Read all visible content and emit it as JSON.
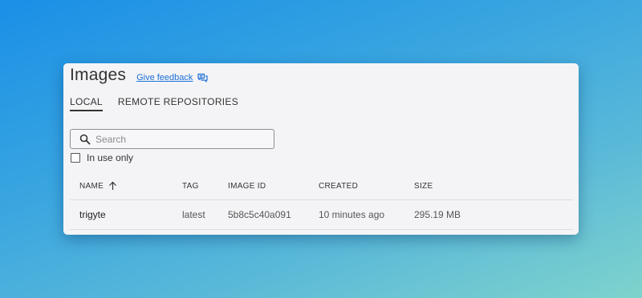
{
  "header": {
    "title": "Images",
    "feedback_label": "Give feedback",
    "feedback_icon": "chat-bubbles-icon"
  },
  "tabs": [
    {
      "label": "LOCAL",
      "active": true
    },
    {
      "label": "REMOTE REPOSITORIES",
      "active": false
    }
  ],
  "search": {
    "placeholder": "Search",
    "value": ""
  },
  "filter": {
    "in_use_only_label": "In use only",
    "checked": false
  },
  "table": {
    "columns": [
      "NAME",
      "TAG",
      "IMAGE ID",
      "CREATED",
      "SIZE"
    ],
    "sort": {
      "column": "NAME",
      "direction": "ascending"
    },
    "rows": [
      {
        "name": "trigyte",
        "tag": "latest",
        "image_id": "5b8c5c40a091",
        "created": "10 minutes ago",
        "size": "295.19 MB"
      }
    ]
  },
  "colors": {
    "accent_link": "#1d6fd6",
    "panel_bg": "#f4f4f6"
  }
}
